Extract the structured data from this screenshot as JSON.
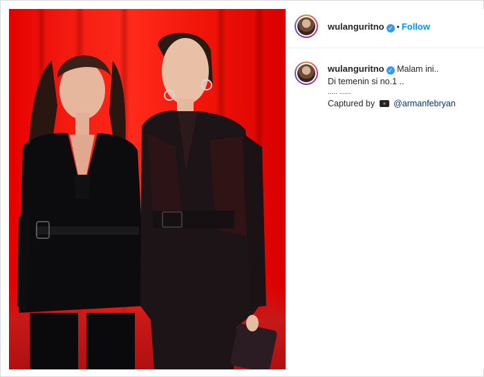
{
  "header": {
    "username": "wulanguritno",
    "separator": "•",
    "follow_label": "Follow"
  },
  "caption": {
    "username": "wulanguritno",
    "line1": "Malam ini..",
    "line2": "Di temenin si no.1 ..",
    "line3": "..... ......",
    "credit_prefix": "Captured by",
    "credit_mention": "@armanfebryan"
  },
  "icons": {
    "verified": "verified-badge-icon",
    "camera": "camera-icon"
  },
  "colors": {
    "follow": "#0095f6",
    "verified": "#3897f0",
    "photo_background": "#ff2a1a"
  }
}
